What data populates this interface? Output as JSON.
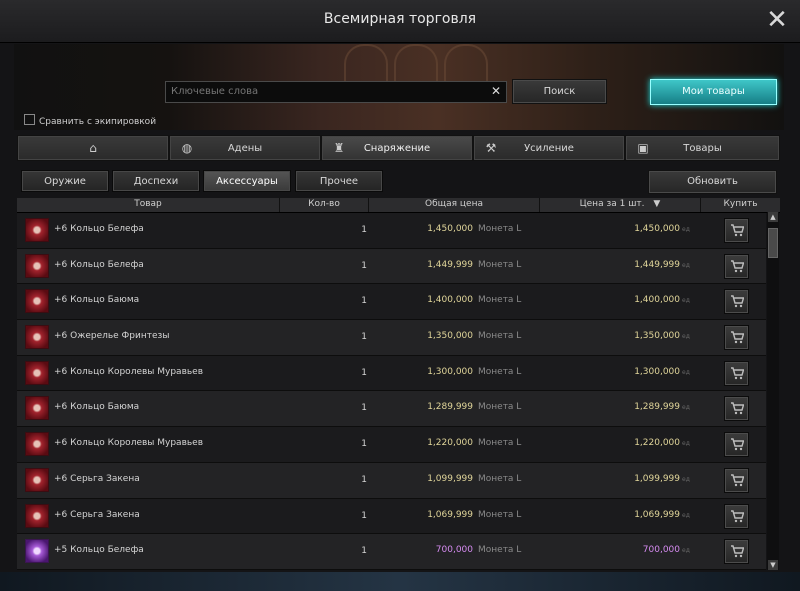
{
  "window": {
    "title": "Всемирная торговля"
  },
  "search": {
    "placeholder": "Ключевые слова",
    "button": "Поиск",
    "my_goods": "Мои товары"
  },
  "compare_label": "Сравнить с экипировкой",
  "tabs": [
    {
      "label": "",
      "icon": "home-icon"
    },
    {
      "label": "Адены",
      "icon": "money-bag-icon"
    },
    {
      "label": "Снаряжение",
      "icon": "armor-icon"
    },
    {
      "label": "Усиление",
      "icon": "anvil-icon"
    },
    {
      "label": "Товары",
      "icon": "box-icon"
    }
  ],
  "active_tab": "Снаряжение",
  "subtabs": [
    "Оружие",
    "Доспехи",
    "Аксессуары",
    "Прочее"
  ],
  "active_subtab": "Аксессуары",
  "refresh": "Обновить",
  "columns": {
    "item": "Товар",
    "qty": "Кол-во",
    "total": "Общая цена",
    "unit": "Цена за 1 шт.",
    "buy": "Купить"
  },
  "rows": [
    {
      "name": "+6 Кольцо Белефа",
      "qty": "1",
      "total": "1,450,000",
      "currency": "Монета L",
      "unit": "1,450,000",
      "unit_currency": "ед",
      "grade": "red"
    },
    {
      "name": "+6 Кольцо Белефа",
      "qty": "1",
      "total": "1,449,999",
      "currency": "Монета L",
      "unit": "1,449,999",
      "unit_currency": "ед",
      "grade": "red"
    },
    {
      "name": "+6 Кольцо Баюма",
      "qty": "1",
      "total": "1,400,000",
      "currency": "Монета L",
      "unit": "1,400,000",
      "unit_currency": "ед",
      "grade": "red"
    },
    {
      "name": "+6 Ожерелье Фринтезы",
      "qty": "1",
      "total": "1,350,000",
      "currency": "Монета L",
      "unit": "1,350,000",
      "unit_currency": "ед",
      "grade": "red"
    },
    {
      "name": "+6 Кольцо Королевы Муравьев",
      "qty": "1",
      "total": "1,300,000",
      "currency": "Монета L",
      "unit": "1,300,000",
      "unit_currency": "ед",
      "grade": "red"
    },
    {
      "name": "+6 Кольцо Баюма",
      "qty": "1",
      "total": "1,289,999",
      "currency": "Монета L",
      "unit": "1,289,999",
      "unit_currency": "ед",
      "grade": "red"
    },
    {
      "name": "+6 Кольцо Королевы Муравьев",
      "qty": "1",
      "total": "1,220,000",
      "currency": "Монета L",
      "unit": "1,220,000",
      "unit_currency": "ед",
      "grade": "red"
    },
    {
      "name": "+6 Серьга Закена",
      "qty": "1",
      "total": "1,099,999",
      "currency": "Монета L",
      "unit": "1,099,999",
      "unit_currency": "ед",
      "grade": "red"
    },
    {
      "name": "+6 Серьга Закена",
      "qty": "1",
      "total": "1,069,999",
      "currency": "Монета L",
      "unit": "1,069,999",
      "unit_currency": "ед",
      "grade": "red"
    },
    {
      "name": "+5 Кольцо Белефа",
      "qty": "1",
      "total": "700,000",
      "currency": "Монета L",
      "unit": "700,000",
      "unit_currency": "ед",
      "grade": "purple"
    }
  ],
  "colors": {
    "price_gold": "#e0d59a",
    "price_purple": "#d58bf0",
    "accent_teal": "#3fc6c8"
  }
}
